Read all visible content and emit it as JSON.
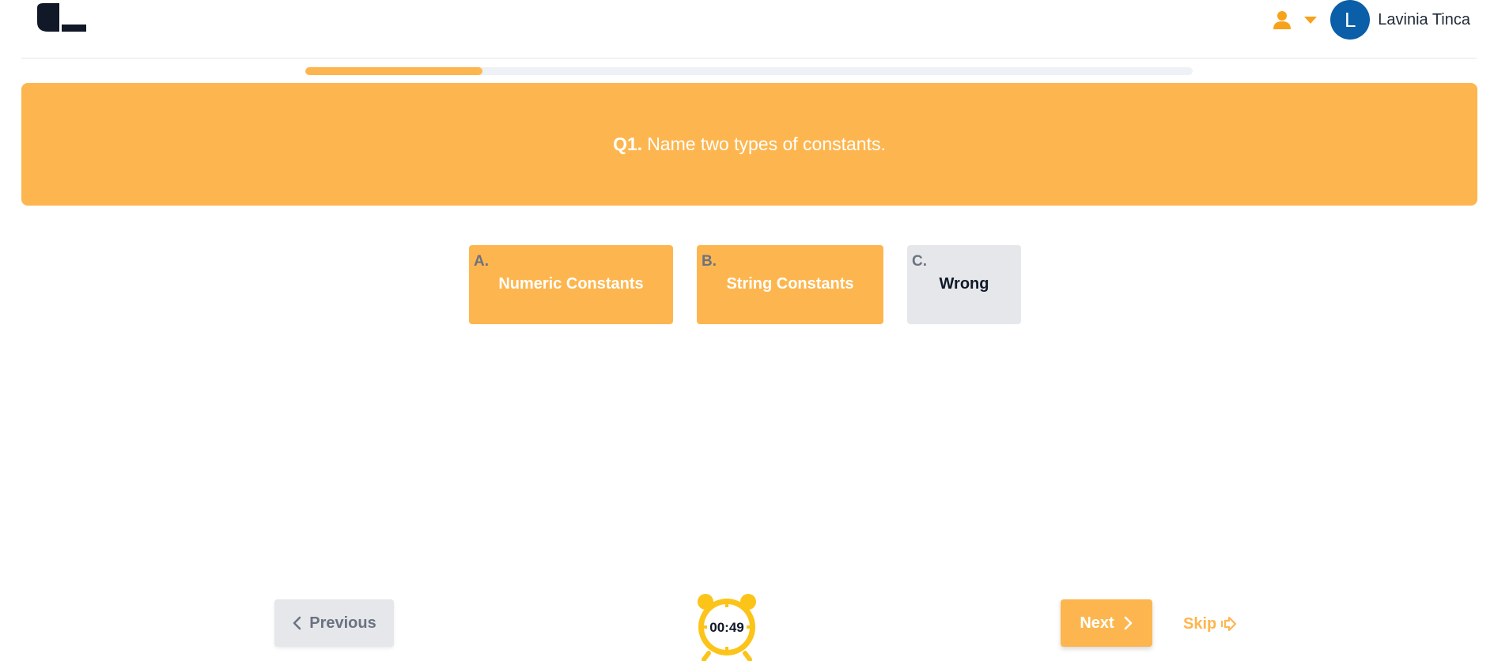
{
  "header": {
    "logo_icon": "brand-logo-icon",
    "user_icon": "person-icon",
    "caret_icon": "caret-down-icon",
    "avatar_initial": "L",
    "user_name": "Lavinia Tinca"
  },
  "progress": {
    "fraction": 0.2
  },
  "question": {
    "number_label": "Q1.",
    "text": "Name two types of constants."
  },
  "options": [
    {
      "letter": "A.",
      "text": "Numeric Constants",
      "state": "selected"
    },
    {
      "letter": "B.",
      "text": "String Constants",
      "state": "selected"
    },
    {
      "letter": "C.",
      "text": "Wrong",
      "state": "unselected"
    }
  ],
  "nav": {
    "previous_label": "Previous",
    "next_label": "Next",
    "skip_label": "Skip",
    "timer_text": "00:49"
  },
  "colors": {
    "accent": "#fdb64f",
    "avatar": "#0b5ea8",
    "timer": "#fcc419",
    "neutral": "#e5e7eb"
  }
}
